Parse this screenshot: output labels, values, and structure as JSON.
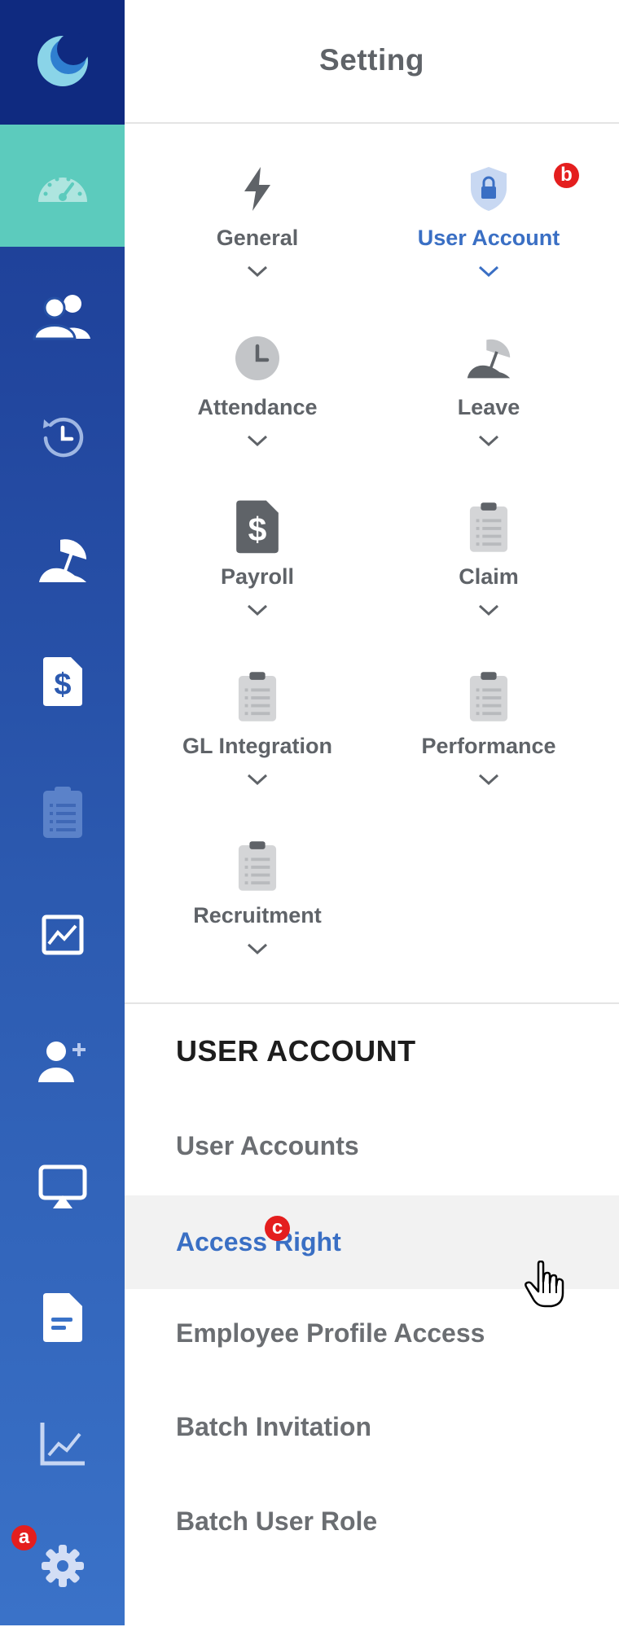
{
  "panel": {
    "title": "Setting"
  },
  "badges": {
    "a": "a",
    "b": "b",
    "c": "c"
  },
  "tiles": [
    {
      "label": "General",
      "icon": "bolt-icon"
    },
    {
      "label": "User Account",
      "icon": "shield-lock-icon",
      "selected": true
    },
    {
      "label": "Attendance",
      "icon": "clock-icon"
    },
    {
      "label": "Leave",
      "icon": "beach-umbrella-icon"
    },
    {
      "label": "Payroll",
      "icon": "dollar-document-icon"
    },
    {
      "label": "Claim",
      "icon": "clipboard-icon"
    },
    {
      "label": "GL Integration",
      "icon": "clipboard-icon"
    },
    {
      "label": "Performance",
      "icon": "clipboard-icon"
    },
    {
      "label": "Recruitment",
      "icon": "clipboard-icon"
    }
  ],
  "section": {
    "title": "USER ACCOUNT",
    "items": [
      {
        "label": "User Accounts"
      },
      {
        "label": "Access Right",
        "active": true
      },
      {
        "label": "Employee Profile Access"
      },
      {
        "label": "Batch Invitation"
      },
      {
        "label": "Batch User Role"
      }
    ]
  },
  "colors": {
    "accent": "#3a6fc4",
    "rail_active": "#5ccbbd",
    "rail_top": "#0f2a80",
    "badge": "#e41e1e"
  }
}
